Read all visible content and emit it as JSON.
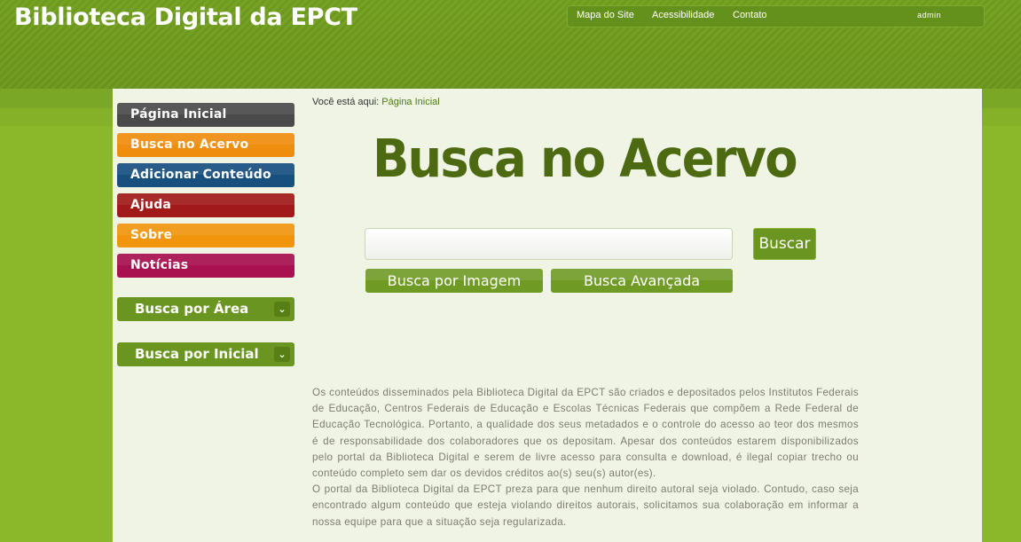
{
  "header": {
    "title": "Biblioteca Digital da EPCT",
    "nav": [
      "Mapa do Site",
      "Acessibilidade",
      "Contato"
    ],
    "user": "admin"
  },
  "sidebar": {
    "items": [
      {
        "label": "Página Inicial",
        "color": "#4a4a4a"
      },
      {
        "label": "Busca no Acervo",
        "color": "#ee8d0e"
      },
      {
        "label": "Adicionar Conteúdo",
        "color": "#174f7e"
      },
      {
        "label": "Ajuda",
        "color": "#a11a19"
      },
      {
        "label": "Sobre",
        "color": "#f0950c"
      },
      {
        "label": "Notícias",
        "color": "#a8104f"
      }
    ],
    "dropdowns": [
      "Busca por Área",
      "Busca por Inicial"
    ]
  },
  "breadcrumb": {
    "prefix": "Você está aqui:",
    "current": "Página Inicial"
  },
  "main": {
    "heading": "Busca no Acervo",
    "search": {
      "value": "",
      "button": "Buscar"
    },
    "buttons": [
      "Busca por Imagem",
      "Busca Avançada"
    ],
    "disclaimer": [
      "Os conteúdos disseminados pela Biblioteca Digital da EPCT são criados e depositados pelos Institutos Federais de Educação, Centros Federais de Educação e Escolas Técnicas Federais que compõem a Rede Federal de Educação Tecnológica. Portanto, a qualidade dos seus metadados e o controle do acesso ao teor dos mesmos é de responsabilidade dos colaboradores que os depositam. Apesar dos conteúdos estarem disponibilizados pelo portal da Biblioteca Digital e serem de livre acesso para consulta e download, é ilegal copiar trecho ou conteúdo completo sem dar os devidos créditos ao(s) seu(s) autor(es).",
      "O portal da Biblioteca Digital da EPCT preza para que nenhum direito autoral seja violado. Contudo, caso seja encontrado algum conteúdo que esteja violando direitos autorais, solicitamos sua colaboração em informar a nossa equipe para que a situação seja regularizada."
    ]
  },
  "colors": {
    "brand_green": "#6a9520",
    "heading_green": "#4d6a12",
    "panel_bg": "#eff4e4"
  }
}
